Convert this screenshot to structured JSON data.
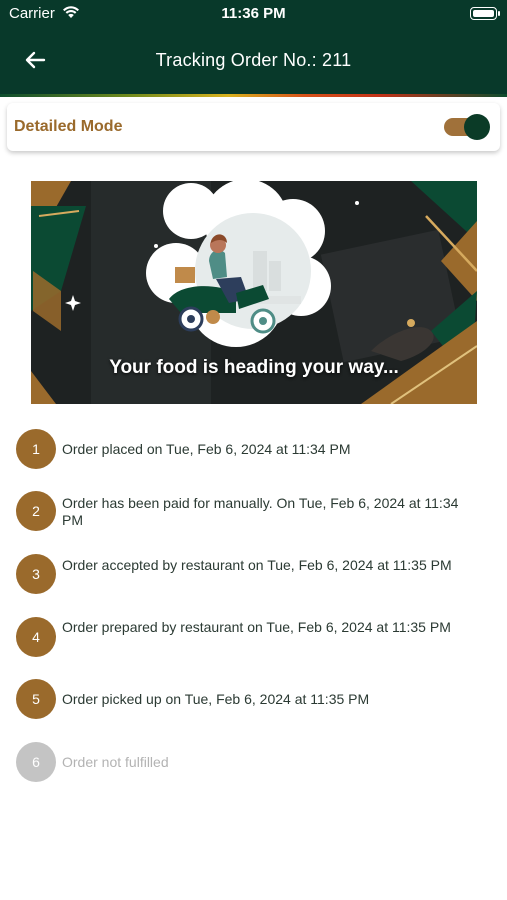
{
  "status_bar": {
    "carrier": "Carrier",
    "time": "11:36 PM"
  },
  "header": {
    "title": "Tracking Order No.: 211",
    "back_icon": "arrow-left-icon"
  },
  "mode": {
    "label": "Detailed Mode",
    "enabled": true
  },
  "banner": {
    "caption": "Your food is heading your way..."
  },
  "steps": [
    {
      "number": "1",
      "text": "Order placed on Tue, Feb 6, 2024 at 11:34 PM",
      "done": true
    },
    {
      "number": "2",
      "text": "Order has been paid for manually. On Tue, Feb 6, 2024 at 11:34 PM",
      "done": true
    },
    {
      "number": "3",
      "text": "Order accepted by restaurant on Tue, Feb 6, 2024 at 11:35 PM",
      "done": true
    },
    {
      "number": "4",
      "text": "Order prepared by restaurant on Tue, Feb 6, 2024 at 11:35 PM",
      "done": true
    },
    {
      "number": "5",
      "text": "Order picked up on Tue, Feb 6, 2024 at 11:35 PM",
      "done": true
    },
    {
      "number": "6",
      "text": "Order not fulfilled",
      "done": false
    }
  ],
  "colors": {
    "header_bg": "#08392a",
    "accent": "#9a6a2c",
    "pending": "#c4c4c4"
  }
}
